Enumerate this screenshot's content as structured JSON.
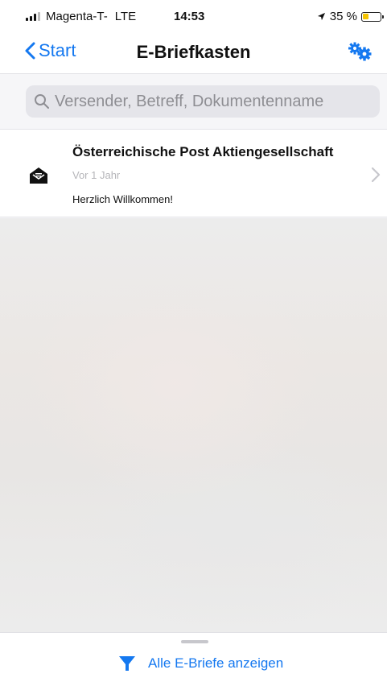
{
  "status_bar": {
    "carrier": "Magenta-T-",
    "network": "LTE",
    "time": "14:53",
    "battery_text": "35 %",
    "battery_level": 0.35,
    "battery_color": "#f5c400"
  },
  "nav": {
    "back_label": "Start",
    "title": "E-Briefkasten",
    "settings_icon": "gears-icon",
    "accent_color": "#1478f0"
  },
  "search": {
    "placeholder": "Versender, Betreff, Dokumentenname",
    "value": ""
  },
  "messages": [
    {
      "sender": "Österreichische Post Aktiengesellschaft",
      "date": "Vor 1 Jahr",
      "subject": "Herzlich Willkommen!",
      "icon": "open-envelope-icon"
    }
  ],
  "bottom_sheet": {
    "filter_label": "Alle E-Briefe anzeigen",
    "filter_icon": "funnel-icon"
  }
}
